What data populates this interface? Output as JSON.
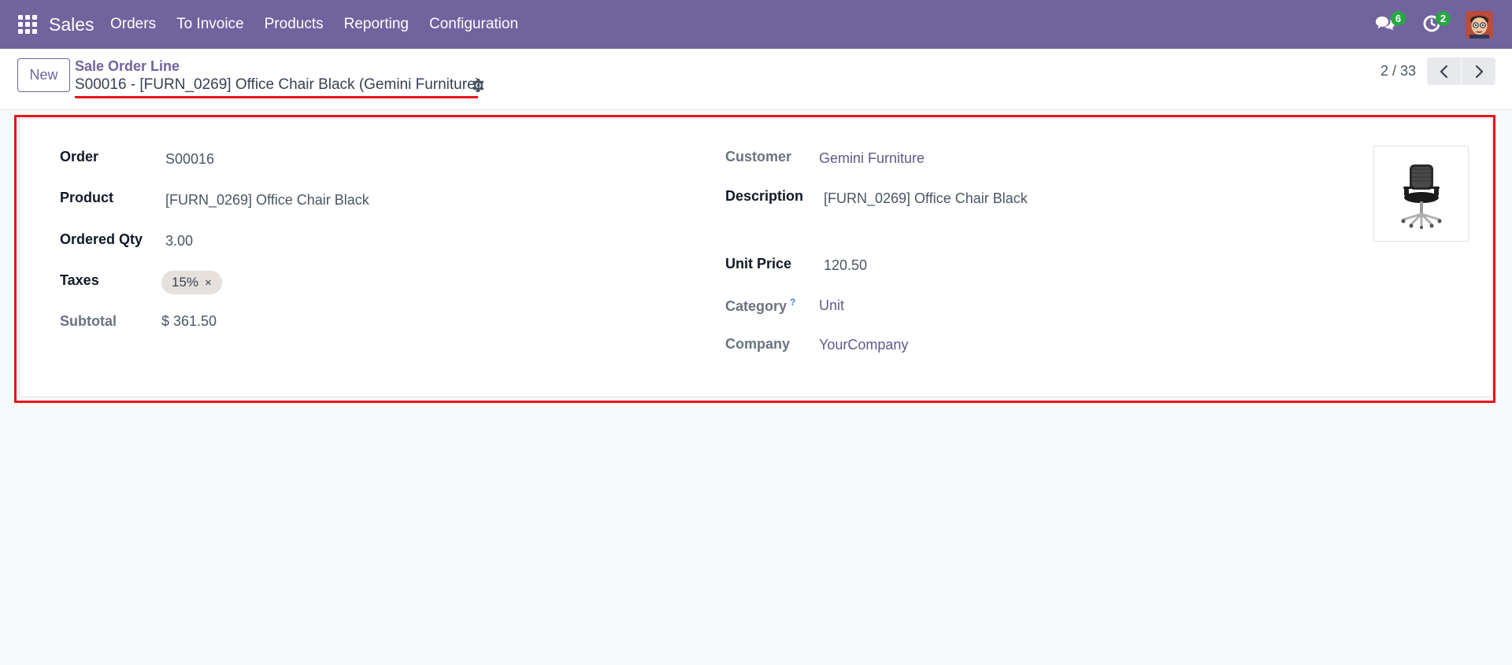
{
  "navbar": {
    "app_name": "Sales",
    "menu": [
      "Orders",
      "To Invoice",
      "Products",
      "Reporting",
      "Configuration"
    ],
    "chat_count": "6",
    "activity_count": "2",
    "icons": [
      "apps-grid-icon",
      "chat-icon",
      "activity-clock-icon",
      "user-avatar"
    ]
  },
  "control_panel": {
    "new_label": "New",
    "breadcrumb": "Sale Order Line",
    "record_title": "S00016 - [FURN_0269] Office Chair Black (Gemini Furniture)",
    "pager": "2 / 33"
  },
  "form": {
    "left": {
      "order_label": "Order",
      "order_value": "S00016",
      "product_label": "Product",
      "product_value": "[FURN_0269] Office Chair Black",
      "qty_label": "Ordered Qty",
      "qty_value": "3.00",
      "taxes_label": "Taxes",
      "tax_tag": "15%",
      "subtotal_label": "Subtotal",
      "subtotal_value": "$ 361.50"
    },
    "right": {
      "customer_label": "Customer",
      "customer_value": "Gemini Furniture",
      "description_label": "Description",
      "description_value": "[FURN_0269] Office Chair Black",
      "unit_price_label": "Unit Price",
      "unit_price_value": "120.50",
      "category_label": "Category",
      "category_help": "?",
      "category_value": "Unit",
      "company_label": "Company",
      "company_value": "YourCompany"
    }
  },
  "colors": {
    "navbar": "#71639e",
    "highlight": "#e8141c",
    "badge": "#28a745"
  }
}
